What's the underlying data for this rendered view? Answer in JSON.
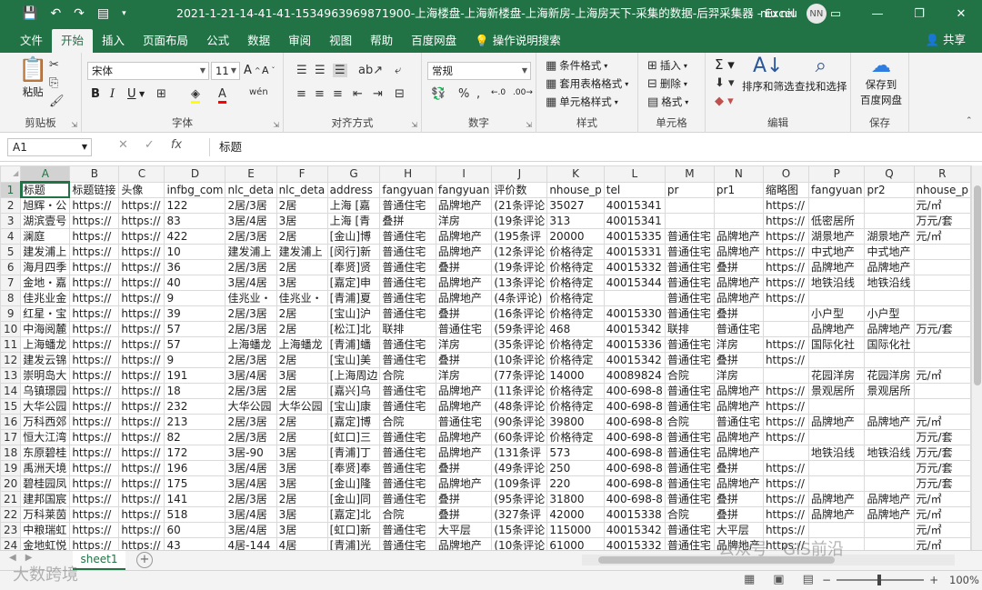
{
  "window": {
    "title": "2021-1-21-14-41-41-1534963969871900-上海楼盘-上海新楼盘-上海新房-上海房天下-采集的数据-后羿采集器 - Excel",
    "user_name": "niu niu",
    "avatar_initials": "NN",
    "accent": "#217346"
  },
  "tabs": [
    "文件",
    "开始",
    "插入",
    "页面布局",
    "公式",
    "数据",
    "审阅",
    "视图",
    "帮助",
    "百度网盘",
    "操作说明搜索"
  ],
  "active_tab": "开始",
  "share_label": "共享",
  "ribbon": {
    "clipboard": {
      "paste": "粘贴",
      "label": "剪贴板"
    },
    "font": {
      "name": "宋体",
      "size": "11",
      "bold": "B",
      "italic": "I",
      "underline": "U",
      "label": "字体"
    },
    "alignment": {
      "label": "对齐方式"
    },
    "number": {
      "format": "常规",
      "label": "数字"
    },
    "styles": {
      "cond": "条件格式",
      "table": "套用表格格式",
      "cell": "单元格样式",
      "label": "样式"
    },
    "cells": {
      "insert": "插入",
      "delete": "删除",
      "format": "格式",
      "label": "单元格"
    },
    "editing": {
      "sort": "排序和筛选",
      "find": "查找和选择",
      "label": "编辑"
    },
    "save": {
      "btn_line1": "保存到",
      "btn_line2": "百度网盘",
      "label": "保存"
    }
  },
  "formula_bar": {
    "name_box": "A1",
    "content": "标题"
  },
  "columns": [
    "A",
    "B",
    "C",
    "D",
    "E",
    "F",
    "G",
    "H",
    "I",
    "J",
    "K",
    "L",
    "M",
    "N",
    "O",
    "P",
    "Q",
    "R"
  ],
  "rows": [
    [
      "标题",
      "标题链接",
      "头像",
      "infbg_com",
      "nlc_deta",
      "nlc_deta",
      "address",
      "fangyuan",
      "fangyuan",
      "评价数",
      "nhouse_p",
      "tel",
      "pr",
      "pr1",
      "缩略图",
      "fangyuan",
      "pr2",
      "nhouse_p"
    ],
    [
      "旭辉・公",
      "https://",
      "https://",
      "122",
      "2居/3居",
      "2居",
      "上海 [嘉",
      "普通住宅",
      "品牌地产",
      "(21条评论",
      "35027",
      "40015341",
      "",
      "",
      "https://",
      "",
      "",
      "元/㎡"
    ],
    [
      "湖滨壹号",
      "https://",
      "https://",
      "83",
      "3居/4居",
      "3居",
      "上海 [青",
      "叠拼",
      "洋房",
      "(19条评论",
      "313",
      "40015341",
      "",
      "",
      "https://",
      "低密居所",
      "",
      "万元/套"
    ],
    [
      "澜庭",
      "https://",
      "https://",
      "422",
      "2居/3居",
      "2居",
      "[金山]博",
      "普通住宅",
      "品牌地产",
      "(195条评",
      "20000",
      "40015335",
      "普通住宅",
      "品牌地产",
      "https://",
      "湖景地产",
      "湖景地产",
      "元/㎡"
    ],
    [
      "建发浦上",
      "https://",
      "https://",
      "10",
      "建发浦上",
      "建发浦上",
      "[闵行]新",
      "普通住宅",
      "品牌地产",
      "(12条评论",
      "价格待定",
      "40015331",
      "普通住宅",
      "品牌地产",
      "https://",
      "中式地产",
      "中式地产",
      ""
    ],
    [
      "海月四季",
      "https://",
      "https://",
      "36",
      "2居/3居",
      "2居",
      "[奉贤]贤",
      "普通住宅",
      "叠拼",
      "(19条评论",
      "价格待定",
      "40015332",
      "普通住宅",
      "叠拼",
      "https://",
      "品牌地产",
      "品牌地产",
      ""
    ],
    [
      "金地・嘉",
      "https://",
      "https://",
      "40",
      "3居/4居",
      "3居",
      "[嘉定]申",
      "普通住宅",
      "品牌地产",
      "(13条评论",
      "价格待定",
      "40015344",
      "普通住宅",
      "品牌地产",
      "https://",
      "地铁沿线",
      "地铁沿线",
      ""
    ],
    [
      "佳兆业金",
      "https://",
      "https://",
      "9",
      "佳兆业・",
      "佳兆业・",
      "[青浦]夏",
      "普通住宅",
      "品牌地产",
      "(4条评论)",
      "价格待定",
      "",
      "普通住宅",
      "品牌地产",
      "https://",
      "",
      "",
      ""
    ],
    [
      "红星・宝",
      "https://",
      "https://",
      "39",
      "2居/3居",
      "2居",
      "[宝山]沪",
      "普通住宅",
      "叠拼",
      "(16条评论",
      "价格待定",
      "40015330",
      "普通住宅",
      "叠拼",
      "",
      "小户型",
      "小户型",
      ""
    ],
    [
      "中海阅麓",
      "https://",
      "https://",
      "57",
      "2居/3居",
      "2居",
      "[松江]北",
      "联排",
      "普通住宅",
      "(59条评论",
      "468",
      "40015342",
      "联排",
      "普通住宅",
      "",
      "品牌地产",
      "品牌地产",
      "万元/套"
    ],
    [
      "上海蟠龙",
      "https://",
      "https://",
      "57",
      "上海蟠龙",
      "上海蟠龙",
      "[青浦]蟠",
      "普通住宅",
      "洋房",
      "(35条评论",
      "价格待定",
      "40015336",
      "普通住宅",
      "洋房",
      "https://",
      "国际化社",
      "国际化社",
      ""
    ],
    [
      "建发云锦",
      "https://",
      "https://",
      "9",
      "2居/3居",
      "2居",
      "[宝山]美",
      "普通住宅",
      "叠拼",
      "(10条评论",
      "价格待定",
      "40015342",
      "普通住宅",
      "叠拼",
      "https://",
      "",
      "",
      ""
    ],
    [
      "崇明岛大",
      "https://",
      "https://",
      "191",
      "3居/4居",
      "3居",
      "[上海周边",
      "合院",
      "洋房",
      "(77条评论",
      "14000",
      "40089824",
      "合院",
      "洋房",
      "",
      "花园洋房",
      "花园洋房",
      "元/㎡"
    ],
    [
      "乌镇璟园",
      "https://",
      "https://",
      "18",
      "2居/3居",
      "2居",
      "[嘉兴]乌",
      "普通住宅",
      "品牌地产",
      "(11条评论",
      "价格待定",
      "400-698-8",
      "普通住宅",
      "品牌地产",
      "https://",
      "景观居所",
      "景观居所",
      ""
    ],
    [
      "大华公园",
      "https://",
      "https://",
      "232",
      "大华公园",
      "大华公园",
      "[宝山]康",
      "普通住宅",
      "品牌地产",
      "(48条评论",
      "价格待定",
      "400-698-8",
      "普通住宅",
      "品牌地产",
      "https://",
      "",
      "",
      ""
    ],
    [
      "万科西郊",
      "https://",
      "https://",
      "213",
      "2居/3居",
      "2居",
      "[嘉定]博",
      "合院",
      "普通住宅",
      "(90条评论",
      "39800",
      "400-698-8",
      "合院",
      "普通住宅",
      "https://",
      "品牌地产",
      "品牌地产",
      "元/㎡"
    ],
    [
      "恒大江湾",
      "https://",
      "https://",
      "82",
      "2居/3居",
      "2居",
      "[虹口]三",
      "普通住宅",
      "品牌地产",
      "(60条评论",
      "价格待定",
      "400-698-8",
      "普通住宅",
      "品牌地产",
      "https://",
      "",
      "",
      "万元/套"
    ],
    [
      "东原碧桂",
      "https://",
      "https://",
      "172",
      "3居-90",
      "3居",
      "[青浦]丁",
      "普通住宅",
      "品牌地产",
      "(131条评",
      "573",
      "400-698-8",
      "普通住宅",
      "品牌地产",
      "",
      "地铁沿线",
      "地铁沿线",
      "万元/套"
    ],
    [
      "禹洲天境",
      "https://",
      "https://",
      "196",
      "3居/4居",
      "3居",
      "[奉贤]奉",
      "普通住宅",
      "叠拼",
      "(49条评论",
      "250",
      "400-698-8",
      "普通住宅",
      "叠拼",
      "https://",
      "",
      "",
      "万元/套"
    ],
    [
      "碧桂园凤",
      "https://",
      "https://",
      "175",
      "3居/4居",
      "3居",
      "[金山]隆",
      "普通住宅",
      "品牌地产",
      "(109条评",
      "220",
      "400-698-8",
      "普通住宅",
      "品牌地产",
      "https://",
      "",
      "",
      "万元/套"
    ],
    [
      "建邦国宸",
      "https://",
      "https://",
      "141",
      "2居/3居",
      "2居",
      "[金山]同",
      "普通住宅",
      "叠拼",
      "(95条评论",
      "31800",
      "400-698-8",
      "普通住宅",
      "叠拼",
      "https://",
      "品牌地产",
      "品牌地产",
      "元/㎡"
    ],
    [
      "万科莱茵",
      "https://",
      "https://",
      "518",
      "3居/4居",
      "3居",
      "[嘉定]北",
      "合院",
      "叠拼",
      "(327条评",
      "42000",
      "40015338",
      "合院",
      "叠拼",
      "https://",
      "品牌地产",
      "品牌地产",
      "元/㎡"
    ],
    [
      "中粮瑞虹",
      "https://",
      "https://",
      "60",
      "3居/4居",
      "3居",
      "[虹口]新",
      "普通住宅",
      "大平层",
      "(15条评论",
      "115000",
      "40015342",
      "普通住宅",
      "大平层",
      "https://",
      "",
      "",
      "元/㎡"
    ],
    [
      "金地虹悦",
      "https://",
      "https://",
      "43",
      "4居-144",
      "4居",
      "[青浦]光",
      "普通住宅",
      "品牌地产",
      "(10条评论",
      "61000",
      "40015332",
      "普通住宅",
      "品牌地产",
      "https://",
      "",
      "",
      "元/㎡"
    ]
  ],
  "sheet_tab": "sheet1",
  "status": {
    "zoom": "100%"
  },
  "watermarks": {
    "left": "大数跨境",
    "right": "公众号 · GIS前沿"
  }
}
